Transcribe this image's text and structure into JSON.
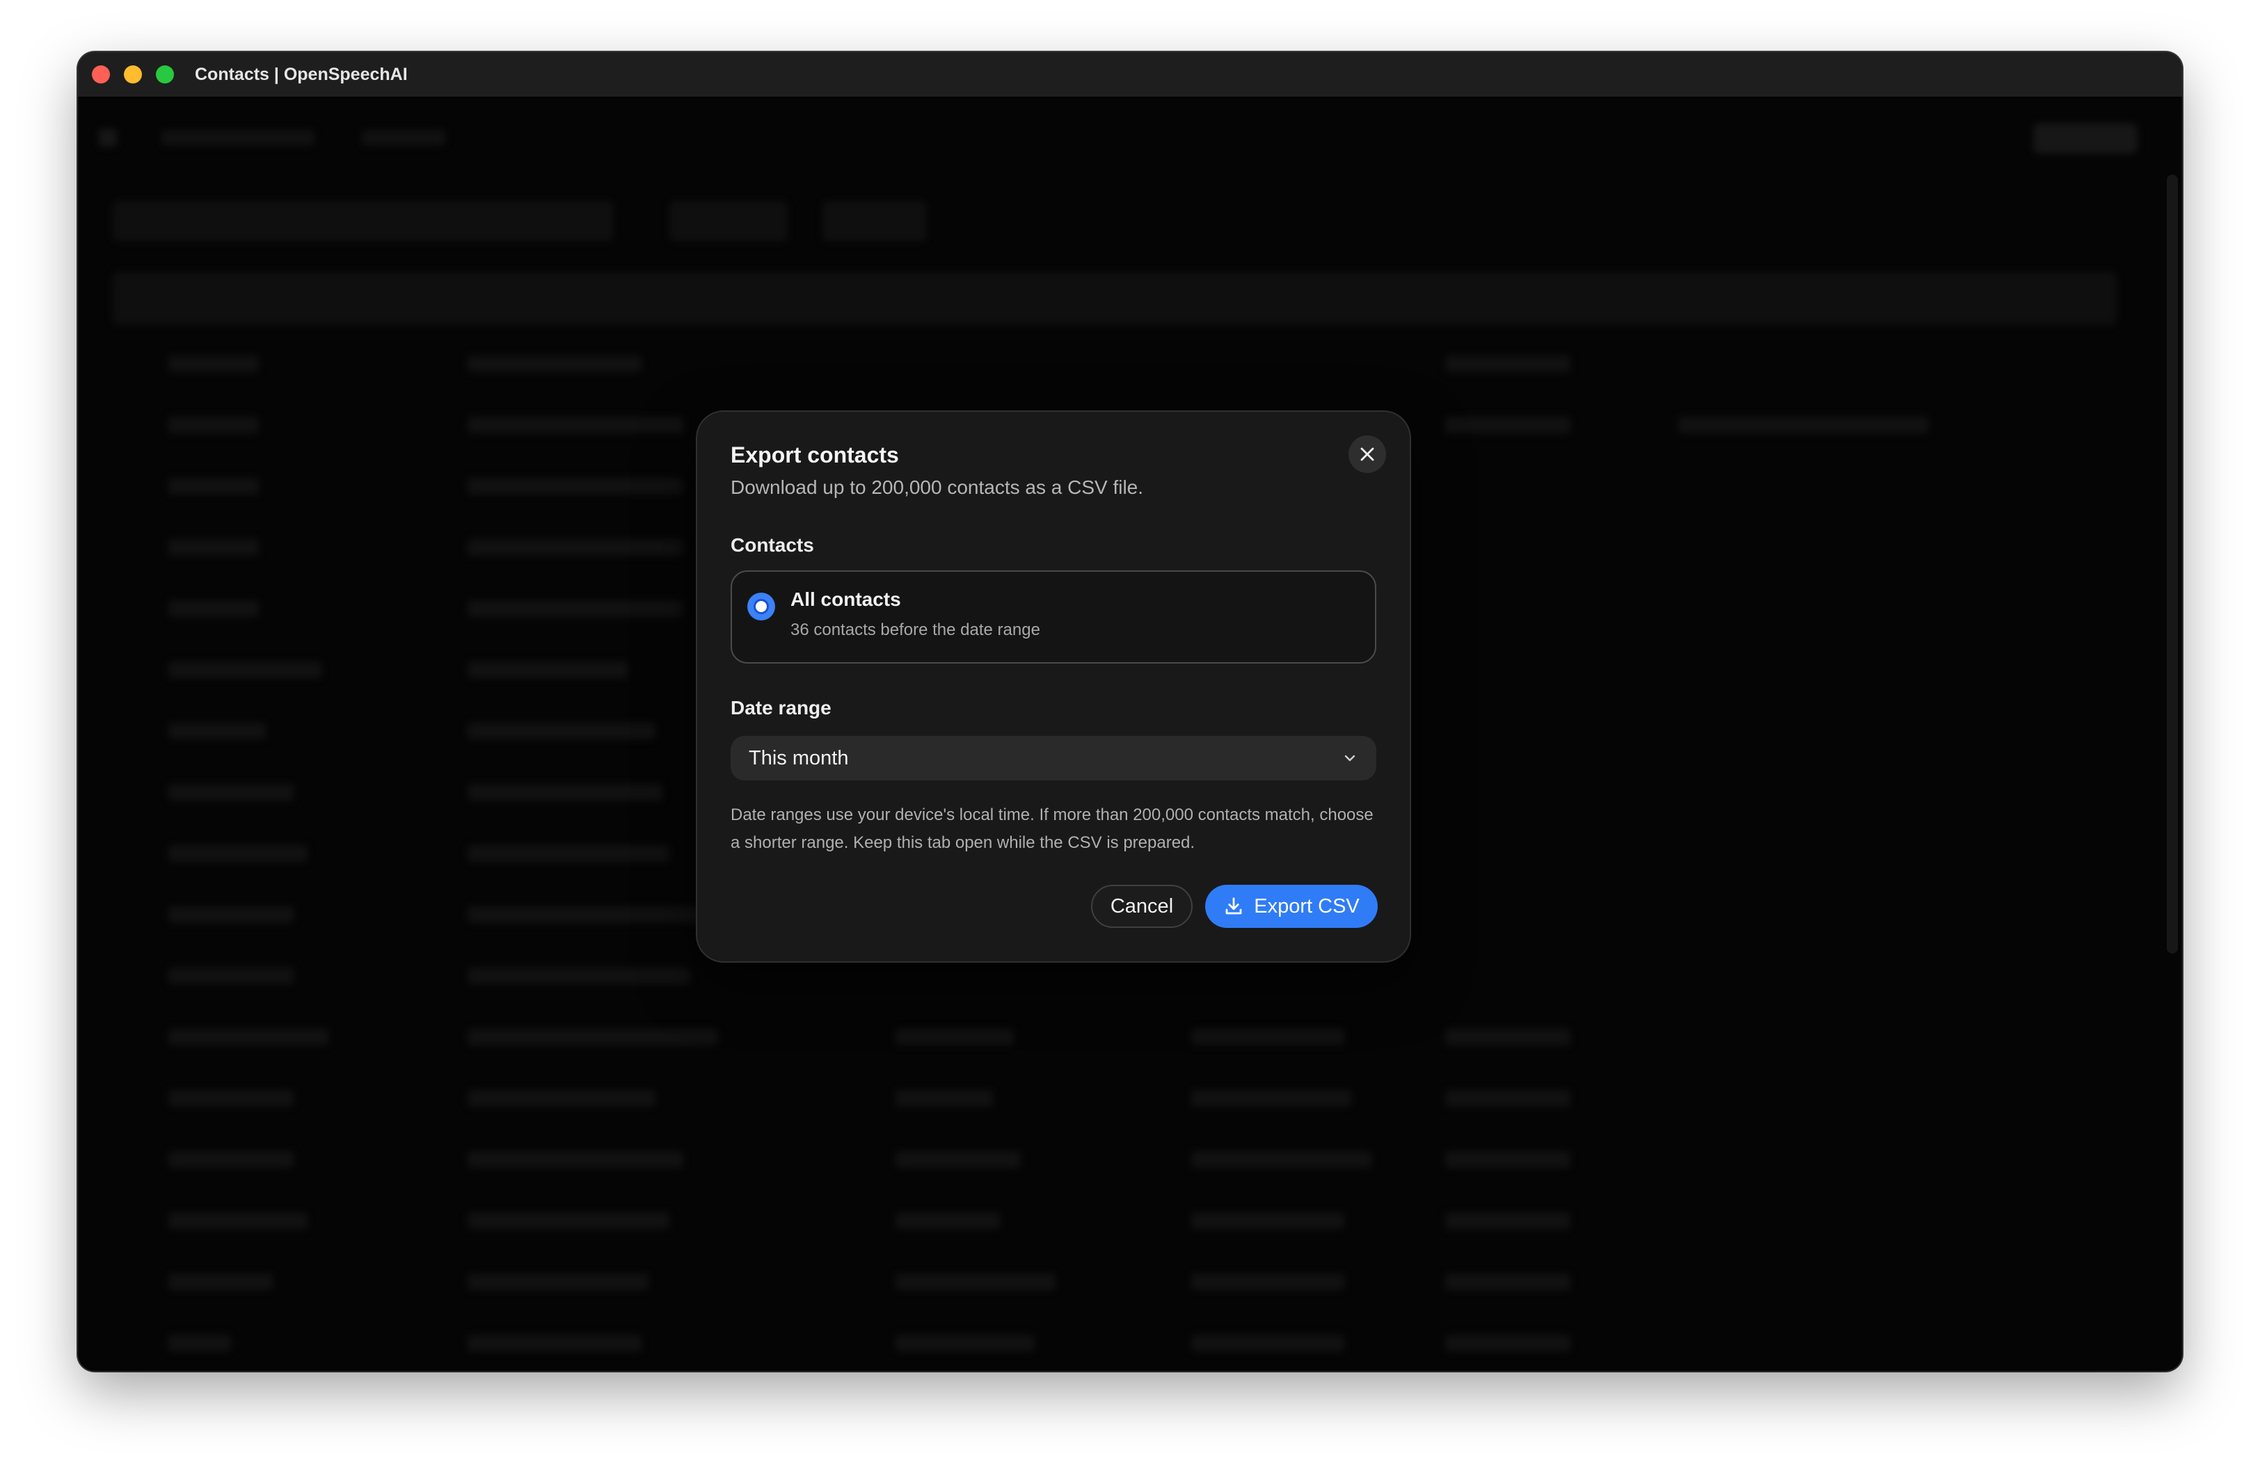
{
  "window": {
    "title": "Contacts | OpenSpeechAI"
  },
  "dialog": {
    "title": "Export contacts",
    "subtitle": "Download up to 200,000 contacts as a CSV file.",
    "contacts_section": {
      "label": "Contacts",
      "option": {
        "title": "All contacts",
        "description": "36 contacts before the date range",
        "selected": true
      }
    },
    "date_range_section": {
      "label": "Date range",
      "selected": "This month"
    },
    "note": "Date ranges use your device's local time. If more than 200,000 contacts match, choose a shorter range. Keep this tab open while the CSV is prepared.",
    "cancel_label": "Cancel",
    "export_label": "Export CSV"
  },
  "colors": {
    "accent": "#2f7cf6",
    "dialog_bg": "#191919",
    "app_bg": "#0a0a0a"
  }
}
